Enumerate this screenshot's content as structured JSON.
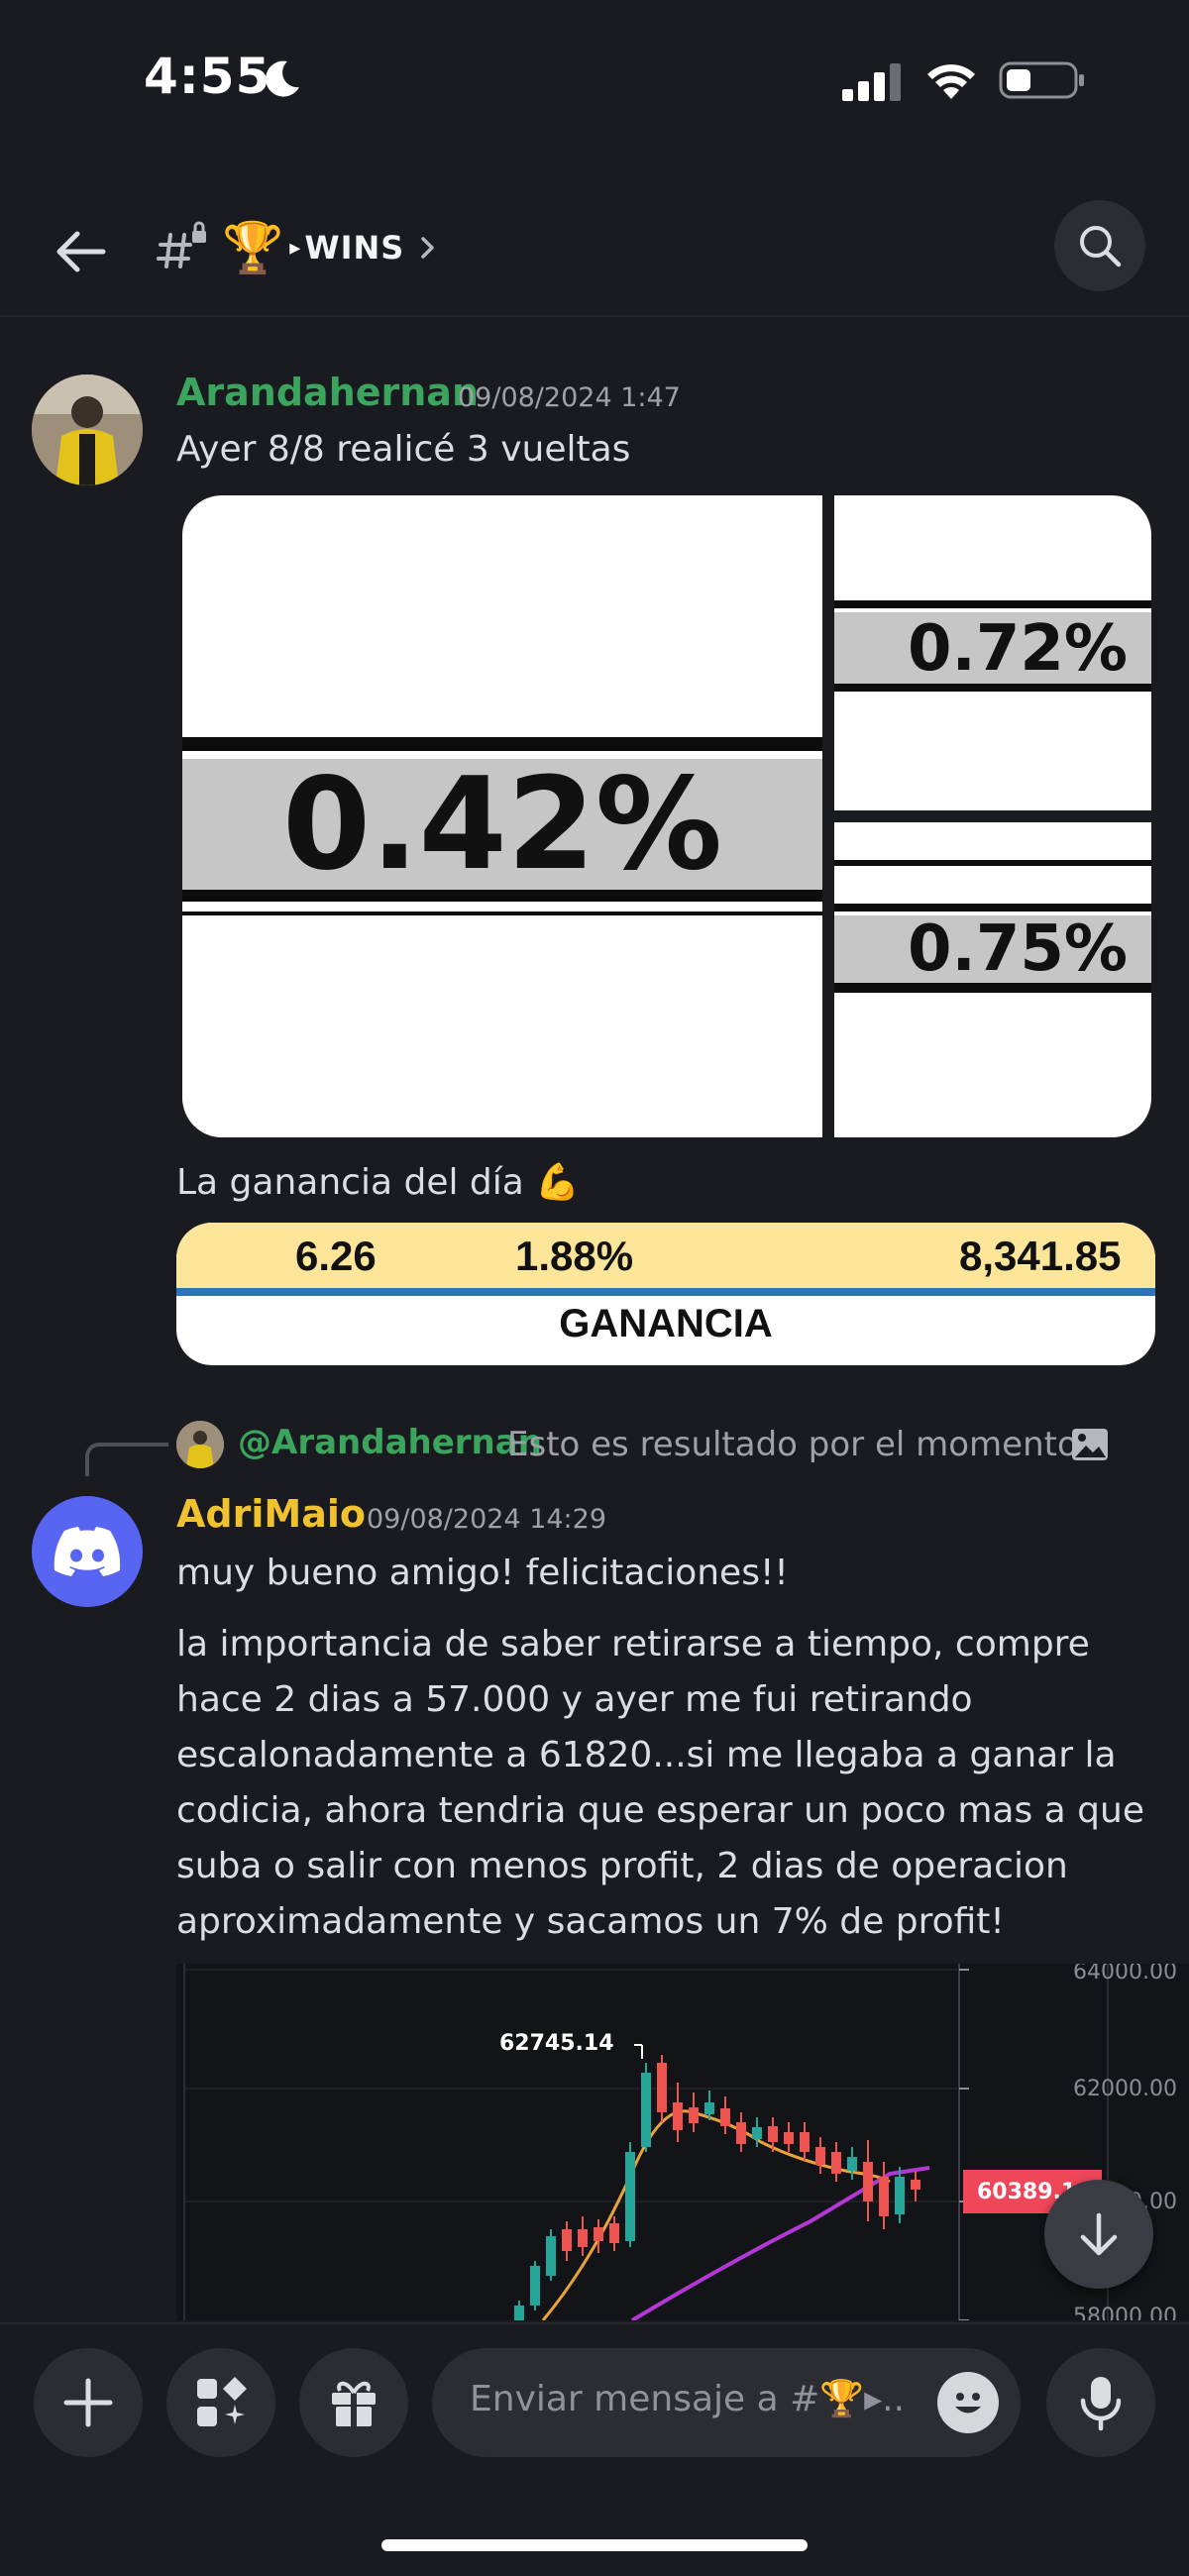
{
  "status_bar": {
    "time": "4:55"
  },
  "header": {
    "channel_prefix": "#",
    "trophy": "🏆",
    "arrow": "▸",
    "channel_name": "WINS"
  },
  "messages": [
    {
      "author": "Arandahernan",
      "timestamp": "09/08/2024 1:47",
      "text": "Ayer 8/8 realicé 3 vueltas",
      "attachment_percentages": [
        "0.42%",
        "0.72%",
        "0.75%"
      ],
      "text2": "La ganancia del día 💪",
      "gain_values": [
        "6.26",
        "1.88%",
        "8,341.85"
      ],
      "gain_label": "GANANCIA"
    },
    {
      "reply": {
        "mention": "@Arandahernan",
        "text": "Esto es resultado por el momento"
      },
      "author": "AdriMaio",
      "timestamp": "09/08/2024 14:29",
      "text": "muy bueno amigo! felicitaciones!!",
      "paragraph_lines": [
        "la importancia de saber retirarse a tiempo, compre",
        "hace 2 dias a 57.000 y ayer me fui retirando",
        "escalonadamente a 61820...si me llegaba a ganar la",
        "codicia, ahora tendria que esperar un poco mas a que",
        "suba o salir con menos profit, 2 dias de operacion",
        "aproximadamente y sacamos un 7% de profit!"
      ],
      "chart_labels": {
        "peak": "62745.14",
        "p64000": "64000.00",
        "p62000": "62000.00",
        "p60000": "60000.00",
        "current": "60389.1",
        "p58000": "58000.00"
      }
    }
  ],
  "composer": {
    "placeholder": "Enviar mensaje a #🏆▸..."
  },
  "colors": {
    "background": "#1a1b20",
    "author_green": "#3ba55d",
    "author_yellow": "#f0c230",
    "discord_blurple": "#5865f2"
  }
}
